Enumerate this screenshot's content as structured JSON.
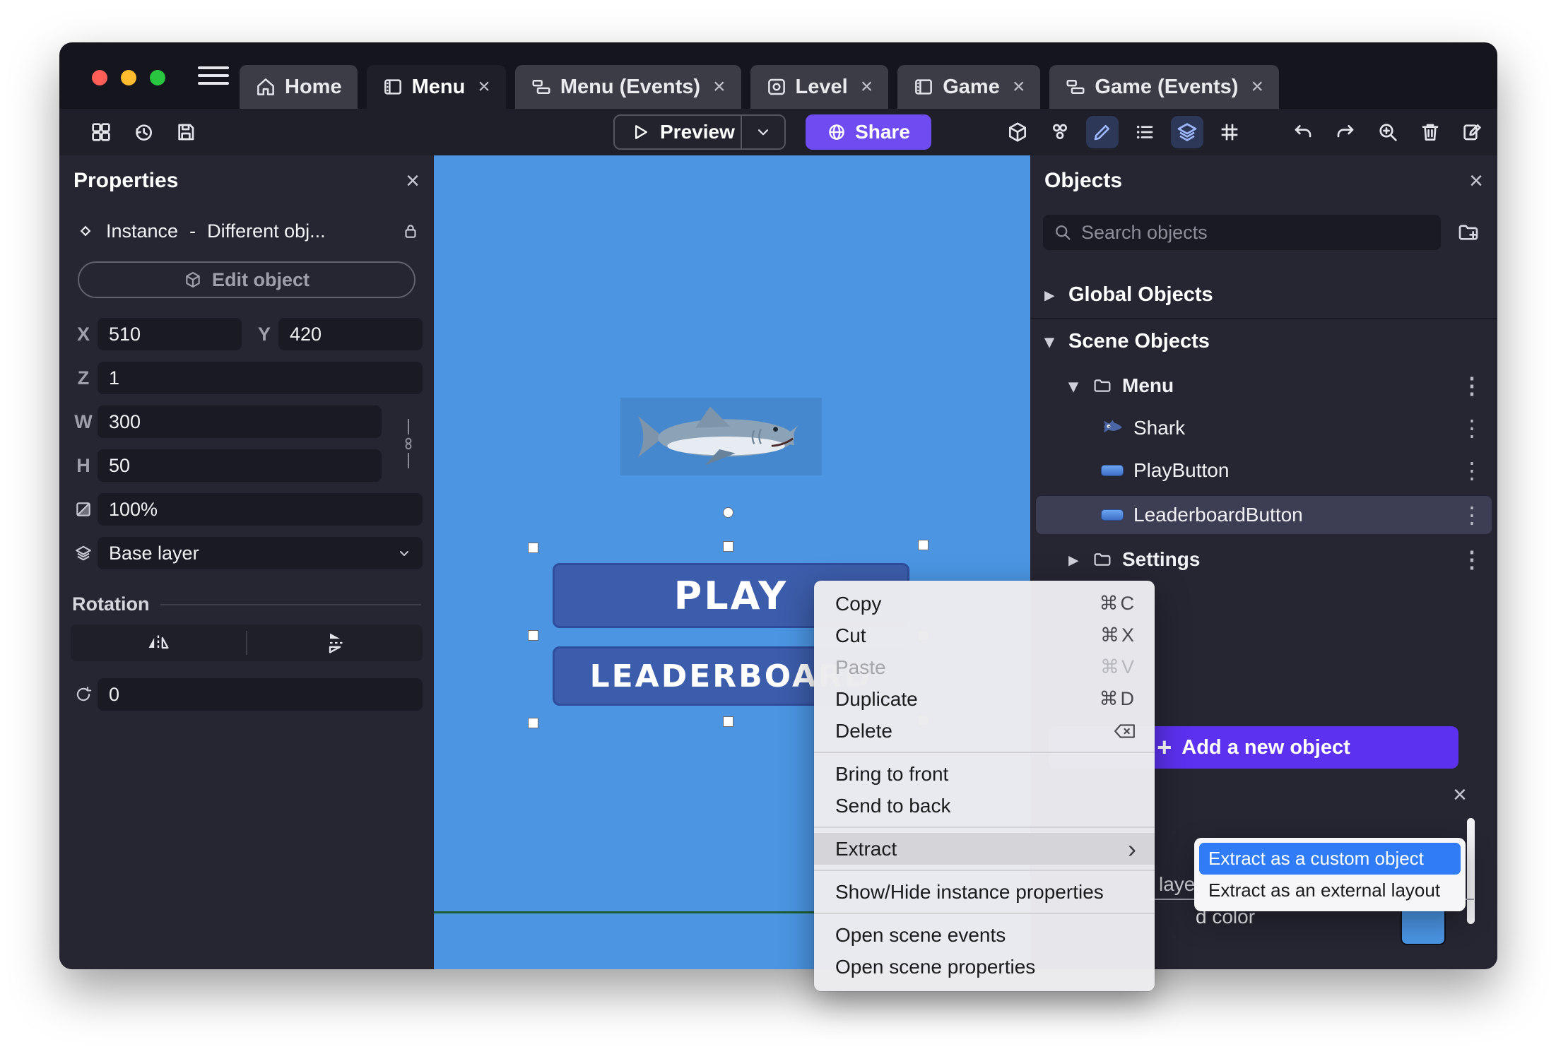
{
  "icons": {
    "close": "×",
    "kebab": "⋮",
    "chevron_down": "▾",
    "chevron_right": "▸",
    "submenu_arrow": "›",
    "plus": "+"
  },
  "titlebar": {
    "tabs": [
      {
        "label": "Home"
      },
      {
        "label": "Menu",
        "active": true
      },
      {
        "label": "Menu (Events)"
      },
      {
        "label": "Level"
      },
      {
        "label": "Game"
      },
      {
        "label": "Game (Events)"
      }
    ]
  },
  "toolbar": {
    "preview_label": "Preview",
    "share_label": "Share"
  },
  "properties_panel": {
    "title": "Properties",
    "instance_label": "Instance",
    "instance_dash": "-",
    "instance_value": "Different obj...",
    "edit_object_label": "Edit object",
    "x_label": "X",
    "x_value": "510",
    "y_label": "Y",
    "y_value": "420",
    "z_label": "Z",
    "z_value": "1",
    "w_label": "W",
    "w_value": "300",
    "h_label": "H",
    "h_value": "50",
    "opacity_value": "100%",
    "layer_value": "Base layer",
    "rotation_title": "Rotation",
    "angle_value": "0"
  },
  "canvas": {
    "play_label": "PLAY",
    "leaderboard_label": "LEADERBOARD"
  },
  "objects_panel": {
    "title": "Objects",
    "search_placeholder": "Search objects",
    "global_objects_label": "Global Objects",
    "scene_objects_label": "Scene Objects",
    "tree": [
      {
        "label": "Menu",
        "type": "folder",
        "expanded": true
      },
      {
        "label": "Shark",
        "type": "object"
      },
      {
        "label": "PlayButton",
        "type": "object"
      },
      {
        "label": "LeaderboardButton",
        "type": "object",
        "selected": true
      },
      {
        "label": "Settings",
        "type": "folder",
        "expanded": false
      }
    ],
    "add_object_label": "Add a new object",
    "partial": {
      "layer_fragment": "layer",
      "color_fragment": "d color"
    }
  },
  "context_menu": {
    "items": [
      {
        "label": "Copy",
        "shortcut": "⌘C"
      },
      {
        "label": "Cut",
        "shortcut": "⌘X"
      },
      {
        "label": "Paste",
        "shortcut": "⌘V",
        "disabled": true
      },
      {
        "label": "Duplicate",
        "shortcut": "⌘D"
      },
      {
        "label": "Delete"
      },
      {
        "label": "Bring to front"
      },
      {
        "label": "Send to back"
      },
      {
        "label": "Extract",
        "has_submenu": true,
        "highlighted": true
      },
      {
        "label": "Show/Hide instance properties"
      },
      {
        "label": "Open scene events"
      },
      {
        "label": "Open scene properties"
      }
    ]
  },
  "submenu": {
    "items": [
      {
        "label": "Extract as a custom object",
        "highlighted": true
      },
      {
        "label": "Extract as an external layout"
      }
    ]
  },
  "colors": {
    "canvas_blue": "#4b95e3",
    "share_purple": "#6f4bf2",
    "add_button_purple": "#5c31f0",
    "submenu_highlight_blue": "#2f7cf6",
    "scene_border_green": "#1f5c33",
    "background_color_swatch": "#4a94e2",
    "traffic_red": "#ff5f57",
    "traffic_yellow": "#febc2e",
    "traffic_green": "#29c73f"
  }
}
